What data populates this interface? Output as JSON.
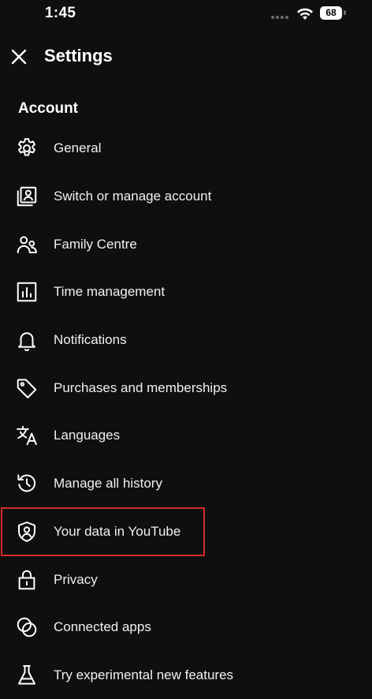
{
  "status_bar": {
    "time": "1:45",
    "battery": "68"
  },
  "header": {
    "title": "Settings",
    "close_icon": "close-icon"
  },
  "section": {
    "title": "Account"
  },
  "menu": {
    "items": [
      {
        "label": "General",
        "icon": "gear-icon"
      },
      {
        "label": "Switch or manage account",
        "icon": "account-box-icon"
      },
      {
        "label": "Family Centre",
        "icon": "family-icon"
      },
      {
        "label": "Time management",
        "icon": "bar-chart-icon"
      },
      {
        "label": "Notifications",
        "icon": "bell-icon"
      },
      {
        "label": "Purchases and memberships",
        "icon": "tag-icon"
      },
      {
        "label": "Languages",
        "icon": "translate-icon"
      },
      {
        "label": "Manage all history",
        "icon": "history-icon"
      },
      {
        "label": "Your data in YouTube",
        "icon": "shield-person-icon"
      },
      {
        "label": "Privacy",
        "icon": "lock-icon"
      },
      {
        "label": "Connected apps",
        "icon": "connected-apps-icon"
      },
      {
        "label": "Try experimental new features",
        "icon": "flask-icon"
      }
    ]
  },
  "colors": {
    "background": "#0f0f0f",
    "text": "#f1f1f1",
    "highlight_border": "#d62a2a"
  }
}
